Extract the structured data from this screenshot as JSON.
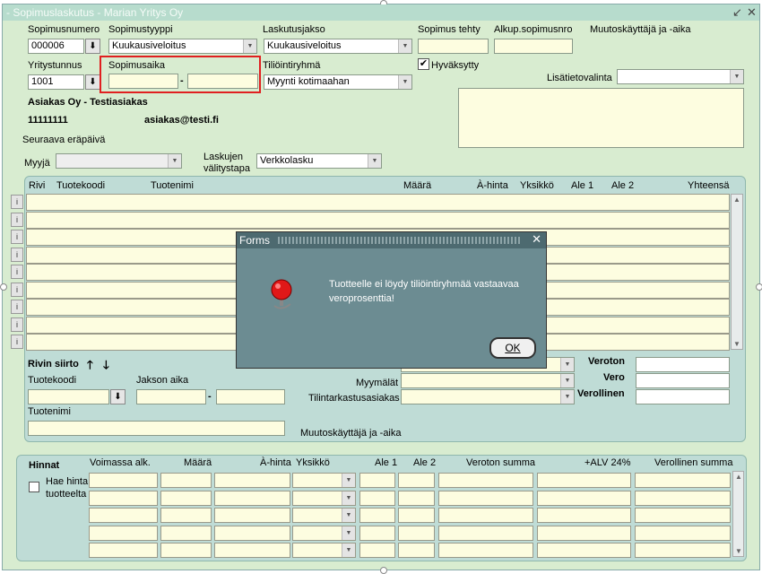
{
  "window": {
    "title": "- Sopimuslaskutus - Marian Yritys Oy",
    "controls": [
      "↙",
      "✕"
    ]
  },
  "header": {
    "sopimusnumero": {
      "label": "Sopimusnumero",
      "value": "000006"
    },
    "sopimustyyppi": {
      "label": "Sopimustyyppi",
      "value": "Kuukausiveloitus"
    },
    "laskutusjakso": {
      "label": "Laskutusjakso",
      "value": "Kuukausiveloitus"
    },
    "sopimus_tehty": {
      "label": "Sopimus tehty",
      "value": ""
    },
    "alkup_sopimusnro": {
      "label": "Alkup.sopimusnro",
      "value": ""
    },
    "muutoskayttaja": {
      "label": "Muutoskäyttäjä ja -aika"
    },
    "yritystunnus": {
      "label": "Yritystunnus",
      "value": "1001"
    },
    "sopimusaika": {
      "label": "Sopimusaika",
      "start": "",
      "end": "",
      "separator": "-"
    },
    "tiliointiryhma": {
      "label": "Tiliöintiryhmä",
      "value": "Myynti kotimaahan"
    },
    "hyvaksytty": {
      "label": "Hyväksytty",
      "checked": true
    },
    "lisatietovalinta": {
      "label": "Lisätietovalinta",
      "value": ""
    },
    "customer_name": "Asiakas Oy - Testiasiakas",
    "customer_id": "11111111",
    "customer_email": "asiakas@testi.fi",
    "seuraava_erapaiva": {
      "label": "Seuraava eräpäivä"
    },
    "myyja": {
      "label": "Myyjä",
      "value": ""
    },
    "laskujen_valitystapa": {
      "label_line1": "Laskujen",
      "label_line2": "välitystapa",
      "value": "Verkkolasku"
    }
  },
  "lines_grid": {
    "columns": [
      "Rivi",
      "Tuotekoodi",
      "Tuotenimi",
      "Määrä",
      "À-hinta",
      "Yksikkö",
      "Ale 1",
      "Ale 2",
      "Yhteensä"
    ],
    "row_button": "i",
    "row_count": 9
  },
  "lower": {
    "rivin_siirto": "Rivin siirto",
    "tuotekoodi": "Tuotekoodi",
    "jakson_aika": "Jakson aika",
    "jakson_sep": "-",
    "tuotenimi": "Tuotenimi",
    "myymalat": "Myymälät",
    "tilintarkastusasiakas": "Tilintarkastusasiakas",
    "muutoskayttaja": "Muutoskäyttäjä ja -aika",
    "veroton": "Veroton",
    "vero": "Vero",
    "verollinen": "Verollinen"
  },
  "prices": {
    "title": "Hinnat",
    "hae_hinta_line1": "Hae hinta",
    "hae_hinta_line2": "tuotteelta",
    "columns": [
      "Voimassa alk.",
      "Määrä",
      "À-hinta",
      "Yksikkö",
      "Ale 1",
      "Ale 2",
      "Veroton summa",
      "+ALV 24%",
      "Verollinen summa"
    ],
    "row_count": 5
  },
  "dialog": {
    "title": "Forms",
    "message_line1": "Tuotteelle ei löydy tiliöintiryhmää vastaavaa",
    "message_line2": "veroprosenttia!",
    "ok_label": "OK",
    "icon": "alarm-bell-icon"
  },
  "colors": {
    "form_bg": "#d8ecd0",
    "panel_bg": "#bfdcd6",
    "field_bg": "#fdfde0",
    "dialog_bg": "#6c8c92",
    "highlight": "#e02020"
  }
}
